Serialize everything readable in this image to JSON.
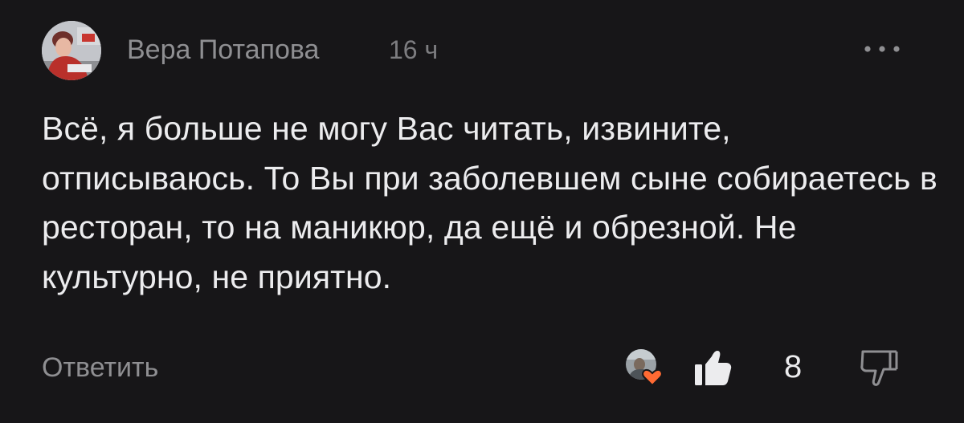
{
  "comment": {
    "author": "Вера Потапова",
    "time": "16 ч",
    "text": "Всё, я больше не могу Вас читать, извините, отписываюсь. То Вы при заболевшем сыне собираетесь в ресторан, то на маникюр, да ещё и обрезной. Не культурно, не приятно.",
    "more_icon": "more-dots-icon"
  },
  "actions": {
    "reply_label": "Ответить",
    "like_icon": "thumbs-up-icon",
    "like_count": "8",
    "dislike_icon": "thumbs-down-icon",
    "reaction_badge_icon": "heart-icon"
  },
  "colors": {
    "background": "#171618",
    "text": "#ececee",
    "muted": "#8f8f92",
    "heart": "#ff6a33"
  }
}
